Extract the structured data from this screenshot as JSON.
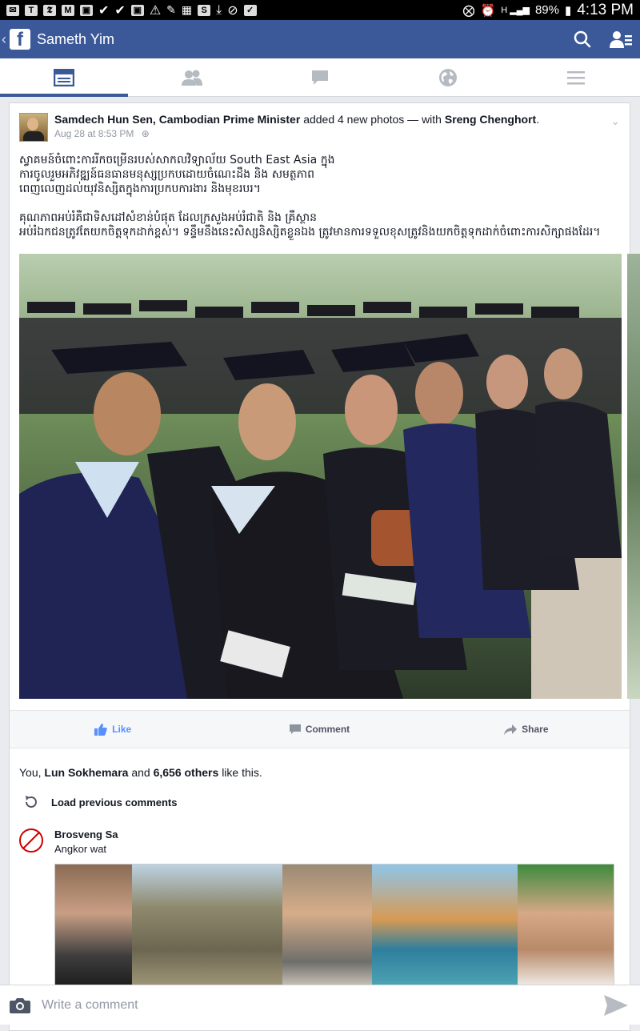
{
  "status_bar": {
    "battery": "89%",
    "time": "4:13 PM"
  },
  "app_bar": {
    "title": "Sameth Yim"
  },
  "post": {
    "author": "Samdech Hun Sen, Cambodian Prime Minister",
    "action": "added 4 new photos — with",
    "tagged": "Sreng Chenghort",
    "timestamp": "Aug 28 at 8:53 PM",
    "text": "ស្វាគមន៍ចំពោះការរីកចម្រើនរបស់សាកលវិទ្យាល័យ South East Asia ក្នុង\nការចូលរួមអភិវឌ្ឍន៍ធនធានមនុស្សប្រកបដោយចំណេះដឹង និង សមត្ថភាព\nពេញលេញដល់យុវនិស្សិតក្នុងការប្រកបការងារ និងមុខរបរ។\n\nគុណភាពអប់រំគឺជាទិសដៅសំខាន់បំផុត ដែលក្រសួងអប់រំជាតិ និង គ្រឹស្ថាន\nអប់រំឯកជនត្រូវតែយកចិត្តទុកដាក់ខ្ពស់។ ទន្ទឹមនឹងនេះសិស្សនិស្សិតខ្លួនឯង ត្រូវមានការទទួលខុសត្រូវនិងយកចិត្តទុកដាក់ចំពោះការសិក្សាផងដែរ។"
  },
  "actions": {
    "like": "Like",
    "comment": "Comment",
    "share": "Share"
  },
  "likes": {
    "prefix": "You,",
    "person": "Lun Sokhemara",
    "and": "and",
    "others": "6,656 others",
    "suffix": "like this."
  },
  "load_previous": "Load previous comments",
  "comment": {
    "name": "Brosveng Sa",
    "text": "Angkor wat"
  },
  "composer": {
    "placeholder": "Write a comment"
  },
  "icons": [
    "facebook-logo",
    "search-icon",
    "friend-requests-icon",
    "news-feed-icon",
    "friends-icon",
    "messages-icon",
    "notifications-globe-icon",
    "menu-icon",
    "like-icon",
    "comment-icon",
    "share-icon",
    "refresh-icon",
    "camera-icon",
    "send-icon"
  ],
  "colors": {
    "brand": "#3b5998",
    "like": "#5890ff"
  }
}
